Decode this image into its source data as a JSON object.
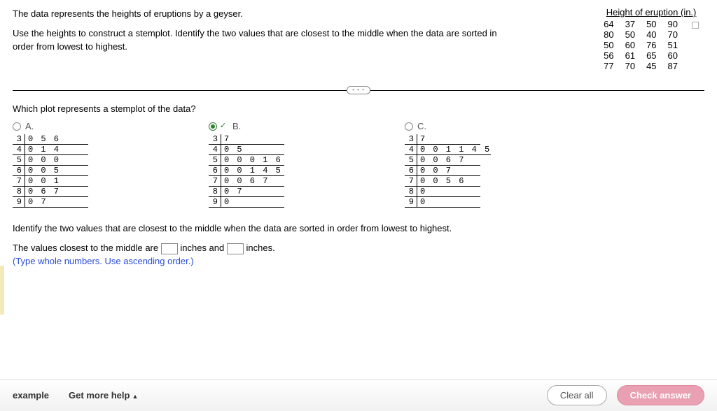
{
  "prompt": {
    "line1": "The data represents the heights of eruptions by a geyser.",
    "line2": "Use the heights to construct a stemplot. Identify the two values that are closest to the middle when the data are sorted in order from lowest to highest."
  },
  "data_table": {
    "header": "Height of eruption (in.)",
    "rows": [
      [
        "64",
        "37",
        "50",
        "90"
      ],
      [
        "80",
        "50",
        "40",
        "70"
      ],
      [
        "50",
        "60",
        "76",
        "51"
      ],
      [
        "56",
        "61",
        "65",
        "60"
      ],
      [
        "77",
        "70",
        "45",
        "87"
      ]
    ]
  },
  "divider_label": "• • •",
  "question1": "Which plot represents a stemplot of the data?",
  "options": {
    "A": {
      "label": "A.",
      "rows": [
        {
          "s": "3",
          "l": "0 5 6"
        },
        {
          "s": "4",
          "l": "0 1 4"
        },
        {
          "s": "5",
          "l": "0 0 0"
        },
        {
          "s": "6",
          "l": "0 0 5"
        },
        {
          "s": "7",
          "l": "0 0 1"
        },
        {
          "s": "8",
          "l": "0 6 7"
        },
        {
          "s": "9",
          "l": "0 7"
        }
      ]
    },
    "B": {
      "label": "B.",
      "rows": [
        {
          "s": "3",
          "l": "7"
        },
        {
          "s": "4",
          "l": "0 5"
        },
        {
          "s": "5",
          "l": "0 0 0 1 6"
        },
        {
          "s": "6",
          "l": "0 0 1 4 5"
        },
        {
          "s": "7",
          "l": "0 0 6 7"
        },
        {
          "s": "8",
          "l": "0 7"
        },
        {
          "s": "9",
          "l": "0"
        }
      ]
    },
    "C": {
      "label": "C.",
      "rows": [
        {
          "s": "3",
          "l": "7"
        },
        {
          "s": "4",
          "l": "0 0 1 1 4 5"
        },
        {
          "s": "5",
          "l": "0 0 6 7"
        },
        {
          "s": "6",
          "l": "0 0 7"
        },
        {
          "s": "7",
          "l": "0 0 5 6"
        },
        {
          "s": "8",
          "l": "0"
        },
        {
          "s": "9",
          "l": "0"
        }
      ]
    }
  },
  "selected_option": "B",
  "question2": "Identify the two values that are closest to the middle when the data are sorted in order from lowest to highest.",
  "fill": {
    "pre": "The values closest to the middle are",
    "mid": "inches and",
    "post": "inches."
  },
  "fill_hint": "(Type whole numbers. Use ascending order.)",
  "footer": {
    "example": "example",
    "help": "Get more help",
    "clear": "Clear all",
    "check": "Check answer"
  }
}
